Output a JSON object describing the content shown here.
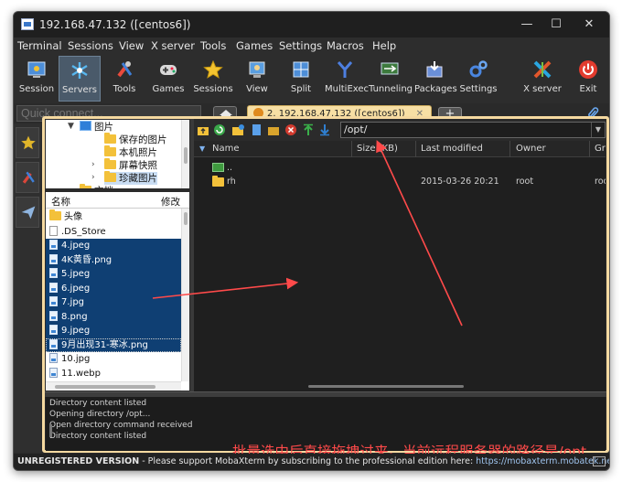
{
  "window": {
    "title": "192.168.47.132 ([centos6])",
    "controls": {
      "minimize": "—",
      "maximize": "☐",
      "close": "✕"
    }
  },
  "menu": [
    "Terminal",
    "Sessions",
    "View",
    "X server",
    "Tools",
    "Games",
    "Settings",
    "Macros",
    "Help"
  ],
  "toolbar": [
    {
      "label": "Session",
      "icon": "session-icon"
    },
    {
      "label": "Servers",
      "icon": "servers-icon",
      "active": true
    },
    {
      "label": "Tools",
      "icon": "tools-icon"
    },
    {
      "label": "Games",
      "icon": "gamepad-icon"
    },
    {
      "label": "Sessions",
      "icon": "star-icon"
    },
    {
      "label": "View",
      "icon": "view-icon"
    },
    {
      "label": "Split",
      "icon": "split-icon"
    },
    {
      "label": "MultiExec",
      "icon": "multiexec-icon"
    },
    {
      "label": "Tunneling",
      "icon": "tunneling-icon"
    },
    {
      "label": "Packages",
      "icon": "packages-icon"
    },
    {
      "label": "Settings",
      "icon": "gears-icon"
    },
    {
      "label": "X server",
      "icon": "xserver-icon"
    },
    {
      "label": "Exit",
      "icon": "power-icon"
    }
  ],
  "quickconnect": {
    "placeholder": "Quick connect..."
  },
  "tabs": {
    "active_label": "2. 192.168.47.132 ([centos6])",
    "close": "✕",
    "new": "+"
  },
  "tree": {
    "items": [
      {
        "label": "图片",
        "kind": "pictures"
      },
      {
        "label": "保存的图片",
        "kind": "folder"
      },
      {
        "label": "本机照片",
        "kind": "folder"
      },
      {
        "label": "屏幕快照",
        "kind": "folder"
      },
      {
        "label": "珍藏图片",
        "kind": "folder"
      },
      {
        "label": "文档",
        "kind": "folder"
      }
    ]
  },
  "local_list": {
    "headers": {
      "name": "名称",
      "modified": "修改"
    },
    "files": [
      {
        "name": "头像",
        "type": "folder",
        "selected": false
      },
      {
        "name": ".DS_Store",
        "type": "blank",
        "selected": false
      },
      {
        "name": "4.jpeg",
        "type": "image",
        "selected": true
      },
      {
        "name": "4K黄昏.png",
        "type": "image",
        "selected": true
      },
      {
        "name": "5.jpeg",
        "type": "image",
        "selected": true
      },
      {
        "name": "6.jpeg",
        "type": "image",
        "selected": true
      },
      {
        "name": "7.jpg",
        "type": "image",
        "selected": true
      },
      {
        "name": "8.png",
        "type": "image",
        "selected": true
      },
      {
        "name": "9.jpeg",
        "type": "image",
        "selected": true
      },
      {
        "name": "9月出现31-寒冰.png",
        "type": "image",
        "selected": true
      },
      {
        "name": "10.jpg",
        "type": "image",
        "selected": false
      },
      {
        "name": "11.webp",
        "type": "image",
        "selected": false
      }
    ]
  },
  "remote": {
    "path": "/opt/",
    "headers": {
      "name": "Name",
      "size": "Size (KB)",
      "modified": "Last modified",
      "owner": "Owner",
      "group": "Gro"
    },
    "rows": [
      {
        "name": "..",
        "type": "up",
        "modified": "",
        "owner": "",
        "group": ""
      },
      {
        "name": "rh",
        "type": "folder",
        "modified": "2015-03-26 20:21",
        "owner": "root",
        "group": "root"
      }
    ]
  },
  "log": [
    "Directory content listed",
    "Opening directory /opt...",
    "Open directory command received",
    "Directory content listed"
  ],
  "annotation": "批量选中后直接拖拽过来。当前远程服务器的路径是/opt",
  "colors": {
    "annotation": "#ff4a4a",
    "accent_frame": "#f5d9a0",
    "selection": "#0f3f73"
  },
  "status": {
    "unregistered": "UNREGISTERED VERSION",
    "message": " -  Please support MobaXterm by subscribing to the professional edition here: ",
    "link": "https://mobaxterm.mobatek.net"
  }
}
